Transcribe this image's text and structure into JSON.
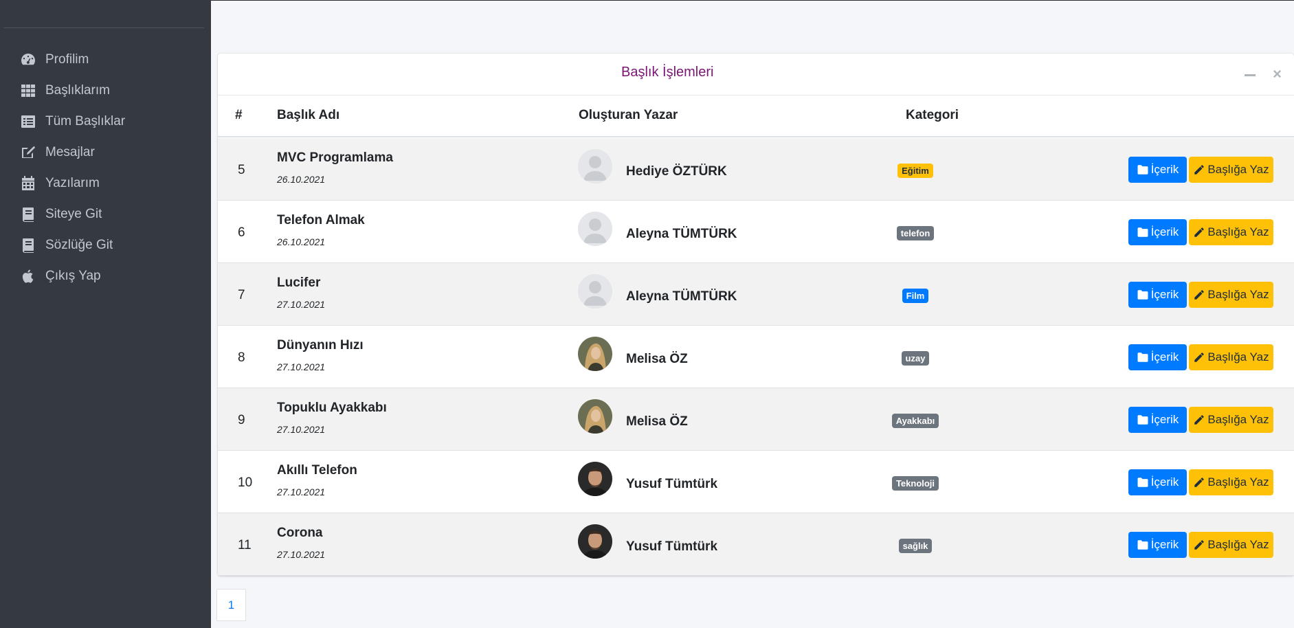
{
  "sidebar": {
    "items": [
      {
        "label": "Profilim",
        "icon": "tachometer-icon"
      },
      {
        "label": "Başlıklarım",
        "icon": "grid-icon"
      },
      {
        "label": "Tüm Başlıklar",
        "icon": "list-icon"
      },
      {
        "label": "Mesajlar",
        "icon": "edit-icon"
      },
      {
        "label": "Yazılarım",
        "icon": "calendar-icon"
      },
      {
        "label": "Siteye Git",
        "icon": "book-icon"
      },
      {
        "label": "Sözlüğe Git",
        "icon": "book-icon"
      },
      {
        "label": "Çıkış Yap",
        "icon": "apple-icon"
      }
    ]
  },
  "card": {
    "title": "Başlık İşlemleri",
    "tools": {
      "collapse_icon": "minus-icon",
      "remove_icon": "times-icon"
    }
  },
  "table": {
    "headers": {
      "num": "#",
      "title": "Başlık Adı",
      "author": "Oluşturan Yazar",
      "category": "Kategori"
    },
    "rows": [
      {
        "num": "5",
        "title": "MVC Programlama",
        "date": "26.10.2021",
        "author": "Hediye ÖZTÜRK",
        "category": "Eğitim",
        "badge_color": "#ffc107",
        "badge_text_color": "#1f2d3d",
        "avatar": "default"
      },
      {
        "num": "6",
        "title": "Telefon Almak",
        "date": "26.10.2021",
        "author": "Aleyna TÜMTÜRK",
        "category": "telefon",
        "badge_color": "#6c757d",
        "badge_text_color": "#ffffff",
        "avatar": "default"
      },
      {
        "num": "7",
        "title": "Lucifer",
        "date": "27.10.2021",
        "author": "Aleyna TÜMTÜRK",
        "category": "Film",
        "badge_color": "#007bff",
        "badge_text_color": "#ffffff",
        "avatar": "default"
      },
      {
        "num": "8",
        "title": "Dünyanın Hızı",
        "date": "27.10.2021",
        "author": "Melisa ÖZ",
        "category": "uzay",
        "badge_color": "#6c757d",
        "badge_text_color": "#ffffff",
        "avatar": "woman"
      },
      {
        "num": "9",
        "title": "Topuklu Ayakkabı",
        "date": "27.10.2021",
        "author": "Melisa ÖZ",
        "category": "Ayakkabı",
        "badge_color": "#6c757d",
        "badge_text_color": "#ffffff",
        "avatar": "woman"
      },
      {
        "num": "10",
        "title": "Akıllı Telefon",
        "date": "27.10.2021",
        "author": "Yusuf Tümtürk",
        "category": "Teknoloji",
        "badge_color": "#6c757d",
        "badge_text_color": "#ffffff",
        "avatar": "man"
      },
      {
        "num": "11",
        "title": "Corona",
        "date": "27.10.2021",
        "author": "Yusuf Tümtürk",
        "category": "sağlık",
        "badge_color": "#6c757d",
        "badge_text_color": "#ffffff",
        "avatar": "man"
      }
    ],
    "buttons": {
      "content_label": "İçerik",
      "content_icon": "folder-icon",
      "write_label": "Başlığa Yaz",
      "write_icon": "pencil-icon"
    }
  },
  "pagination": {
    "current": "1"
  },
  "colors": {
    "sidebar_bg": "#343a40",
    "primary": "#007bff",
    "warning": "#ffc107",
    "secondary": "#6c757d",
    "title": "#7a1575"
  }
}
